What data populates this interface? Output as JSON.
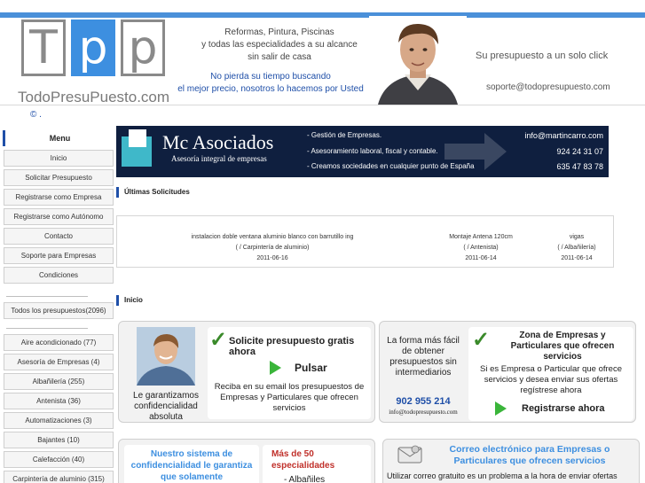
{
  "header": {
    "logo_letters": [
      "T",
      "p",
      "p"
    ],
    "logo_text": "TodoPresuPuesto.com",
    "tagline_lines": [
      "Reformas, Pintura, Piscinas",
      "y todas las especialidades a su alcance",
      "sin salir de casa"
    ],
    "highlight_lines": [
      "No pierda su tiempo buscando",
      "el mejor precio, nosotros lo hacemos por Usted"
    ],
    "slogan": "Su presupuesto a un solo click",
    "support_email": "soporte@todopresupuesto.com"
  },
  "breadcrumb": "© .",
  "sidebar": {
    "menu_title": "Menu",
    "items": [
      "Inicio",
      "Solicitar Presupuesto",
      "Registrarse como Empresa",
      "Registrarse como Autónomo",
      "Contacto",
      "Soporte para Empresas",
      "Condiciones"
    ],
    "all_budgets": "Todos los presupuestos(2096)",
    "categories": [
      "Aire acondicionado (77)",
      "Asesoría de Empresas (4)",
      "Albañilería (255)",
      "Antenista (36)",
      "Automatizaciones (3)",
      "Bajantes (10)",
      "Calefacción (40)",
      "Carpintería de aluminio (315)"
    ]
  },
  "banner": {
    "brand": "Mc Asociados",
    "subtitle": "Asesoría integral de empresas",
    "lines": [
      "- Gestión de  Empresas.",
      "- Asesoramiento laboral, fiscal y contable.",
      "- Creamos sociedades en cualquier punto de España"
    ],
    "email": "info@martincarro.com",
    "phone1": "924 24 31 07",
    "phone2": "635 47 83 78"
  },
  "requests": {
    "title": "Últimas Solicitudes",
    "items": [
      {
        "title": "instalacion doble ventana aluminio blanco con barrutillo ing",
        "category": "( / Carpintería de aluminio)",
        "date": "2011-06-16"
      },
      {
        "title": "Montaje Antena 120cm",
        "category": "( / Antenista)",
        "date": "2011-06-14"
      },
      {
        "title": "vigas",
        "category": "( / Albañilería)",
        "date": "2011-06-14"
      }
    ]
  },
  "home": {
    "title": "Inicio",
    "left_panel": {
      "headline": "Solicite presupuesto gratis ahora",
      "action": "Pulsar",
      "guarantee": "Le garantizamos confidencialidad absoluta",
      "description": "Reciba en su email los presupuestos de Empresas y Particulares que ofrecen servicios"
    },
    "right_panel": {
      "intro": "La forma más fácil de obtener presupuestos sin intermediarios",
      "phone": "902 955 214",
      "email": "info@todopresupuesto.com",
      "headline": "Zona de Empresas y Particulares que ofrecen servicios",
      "description": "Si es  Empresa o Particular que ofrece servicios y desea enviar sus ofertas  regístrese ahora",
      "action": "Registrarse ahora"
    },
    "bottom_left": {
      "confidentiality": "Nuestro sistema de confidencialidad le garantiza que solamente",
      "specialties_title": "Más de 50 especialidades",
      "specialties_first": "- Albañiles"
    },
    "bottom_right": {
      "headline": "Correo electrónico para Empresas o Particulares que ofrecen servicios",
      "description": "Utilizar correo gratuito es un problema a la hora de enviar ofertas"
    }
  },
  "colors": {
    "accent": "#3d8fe0",
    "nav_blue": "#1f4fa8",
    "green": "#3ab53a",
    "highlight_red": "#c0302a"
  }
}
